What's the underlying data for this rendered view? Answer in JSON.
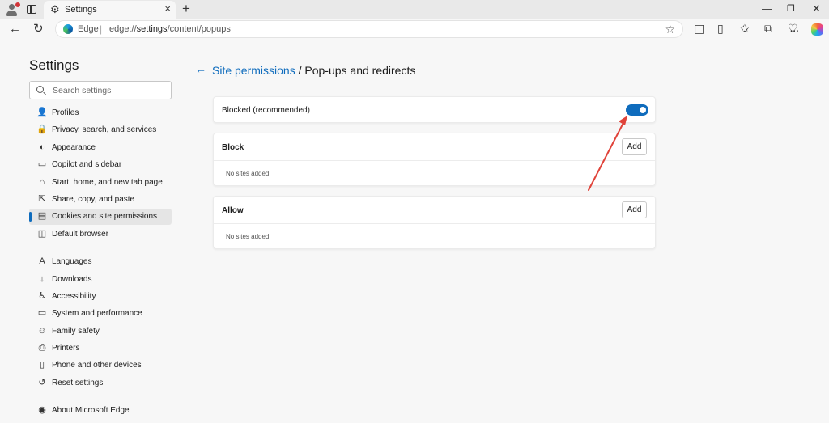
{
  "tab": {
    "title": "Settings"
  },
  "window_controls": {
    "minimize": "—",
    "restore": "❐",
    "close": "✕"
  },
  "address_bar": {
    "site_label": "Edge",
    "url_prefix": "edge://",
    "url_path": "settings",
    "url_suffix": "/content/popups"
  },
  "sidebar": {
    "title": "Settings",
    "search_placeholder": "Search settings",
    "items": [
      {
        "label": "Profiles",
        "icon": "profile-icon",
        "glyph": "👤"
      },
      {
        "label": "Privacy, search, and services",
        "icon": "lock-icon",
        "glyph": "🔒"
      },
      {
        "label": "Appearance",
        "icon": "palette-icon",
        "glyph": "◐"
      },
      {
        "label": "Copilot and sidebar",
        "icon": "sidebar-icon",
        "glyph": "▭"
      },
      {
        "label": "Start, home, and new tab page",
        "icon": "home-icon",
        "glyph": "⌂"
      },
      {
        "label": "Share, copy, and paste",
        "icon": "share-icon",
        "glyph": "⇱"
      },
      {
        "label": "Cookies and site permissions",
        "icon": "cookie-permissions-icon",
        "glyph": "▤"
      },
      {
        "label": "Default browser",
        "icon": "browser-icon",
        "glyph": "◫"
      },
      {
        "label": "Languages",
        "icon": "languages-icon",
        "glyph": "A"
      },
      {
        "label": "Downloads",
        "icon": "download-icon",
        "glyph": "↓"
      },
      {
        "label": "Accessibility",
        "icon": "accessibility-icon",
        "glyph": "♿"
      },
      {
        "label": "System and performance",
        "icon": "laptop-icon",
        "glyph": "▭"
      },
      {
        "label": "Family safety",
        "icon": "family-icon",
        "glyph": "☺"
      },
      {
        "label": "Printers",
        "icon": "printer-icon",
        "glyph": "⎙"
      },
      {
        "label": "Phone and other devices",
        "icon": "phone-icon",
        "glyph": "▯"
      },
      {
        "label": "Reset settings",
        "icon": "reset-icon",
        "glyph": "↺"
      },
      {
        "label": "About Microsoft Edge",
        "icon": "edge-icon",
        "glyph": "◉"
      }
    ]
  },
  "main": {
    "breadcrumb_parent": "Site permissions",
    "breadcrumb_separator": " / ",
    "breadcrumb_current": "Pop-ups and redirects",
    "blocked_label": "Blocked (recommended)",
    "blocked_toggle_on": true,
    "block_section": {
      "title": "Block",
      "add_label": "Add",
      "empty_text": "No sites added"
    },
    "allow_section": {
      "title": "Allow",
      "add_label": "Add",
      "empty_text": "No sites added"
    }
  },
  "colors": {
    "accent": "#0f6cbd",
    "annotation_arrow": "#e0433a"
  }
}
